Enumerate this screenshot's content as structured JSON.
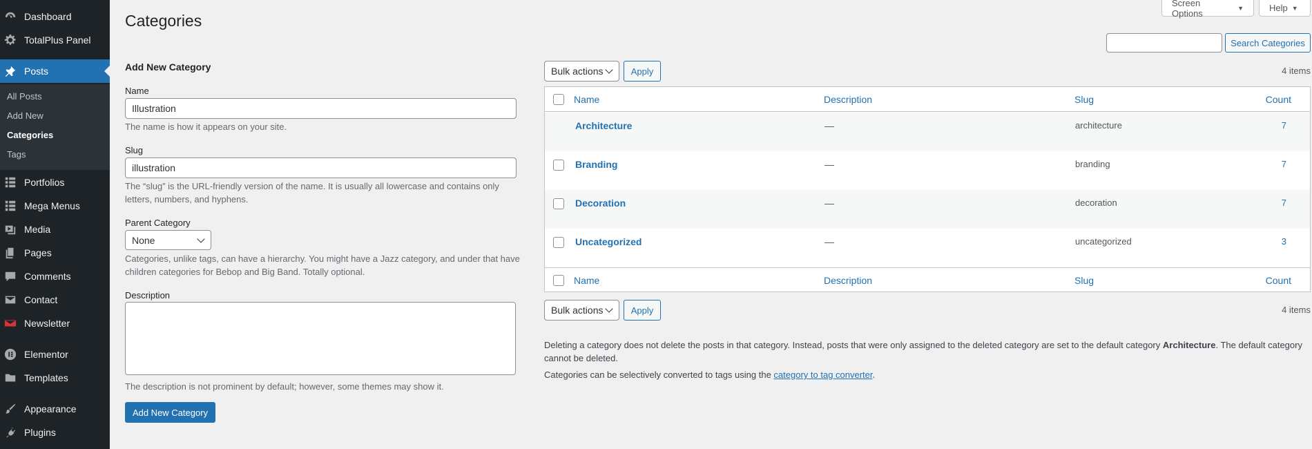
{
  "sidebar": {
    "items": [
      {
        "label": "Dashboard",
        "icon": "dashboard-icon"
      },
      {
        "label": "TotalPlus Panel",
        "icon": "gear-icon"
      },
      {
        "label": "Posts",
        "icon": "pin-icon"
      },
      {
        "label": "Portfolios",
        "icon": "grid-icon"
      },
      {
        "label": "Mega Menus",
        "icon": "grid-icon"
      },
      {
        "label": "Media",
        "icon": "media-icon"
      },
      {
        "label": "Pages",
        "icon": "pages-icon"
      },
      {
        "label": "Comments",
        "icon": "comment-icon"
      },
      {
        "label": "Contact",
        "icon": "mail-icon"
      },
      {
        "label": "Newsletter",
        "icon": "newsletter-icon"
      },
      {
        "label": "Elementor",
        "icon": "elementor-icon"
      },
      {
        "label": "Templates",
        "icon": "folder-icon"
      },
      {
        "label": "Appearance",
        "icon": "brush-icon"
      },
      {
        "label": "Plugins",
        "icon": "plug-icon"
      }
    ],
    "submenu": [
      "All Posts",
      "Add New",
      "Categories",
      "Tags"
    ]
  },
  "topbar": {
    "screen_options": "Screen Options",
    "help": "Help"
  },
  "page": {
    "title": "Categories"
  },
  "search": {
    "placeholder": "",
    "button": "Search Categories"
  },
  "form": {
    "heading": "Add New Category",
    "name_label": "Name",
    "name_value": "Illustration",
    "name_help": "The name is how it appears on your site.",
    "slug_label": "Slug",
    "slug_value": "illustration",
    "slug_help_1": "The “slug” is the URL-friendly version of the name. It is usually all lowercase and contains only",
    "slug_help_2": "letters, numbers, and hyphens.",
    "parent_label": "Parent Category",
    "parent_value": "None",
    "parent_help_1": "Categories, unlike tags, can have a hierarchy. You might have a Jazz category, and under that have",
    "parent_help_2": "children categories for Bebop and Big Band. Totally optional.",
    "description_label": "Description",
    "description_value": "",
    "description_help": "The description is not prominent by default; however, some themes may show it.",
    "submit": "Add New Category"
  },
  "table": {
    "bulk_actions": "Bulk actions",
    "apply": "Apply",
    "items_count": "4 items",
    "columns": {
      "name": "Name",
      "description": "Description",
      "slug": "Slug",
      "count": "Count"
    },
    "rows": [
      {
        "name": "Architecture",
        "description": "—",
        "slug": "architecture",
        "count": "7"
      },
      {
        "name": "Branding",
        "description": "—",
        "slug": "branding",
        "count": "7"
      },
      {
        "name": "Decoration",
        "description": "—",
        "slug": "decoration",
        "count": "7"
      },
      {
        "name": "Uncategorized",
        "description": "—",
        "slug": "uncategorized",
        "count": "3"
      }
    ]
  },
  "notes": {
    "delete_1_a": "Deleting a category does not delete the posts in that category. Instead, posts that were only assigned to the deleted category are set to the default category ",
    "delete_1_b": "Architecture",
    "delete_1_c": ". The default category",
    "delete_2": "cannot be deleted.",
    "convert_a": "Categories can be selectively converted to tags using the ",
    "convert_link": "category to tag converter",
    "convert_b": "."
  },
  "colors": {
    "accent": "#2271b1",
    "sidebar_bg": "#1d2327",
    "page_bg": "#f0f0f1"
  }
}
